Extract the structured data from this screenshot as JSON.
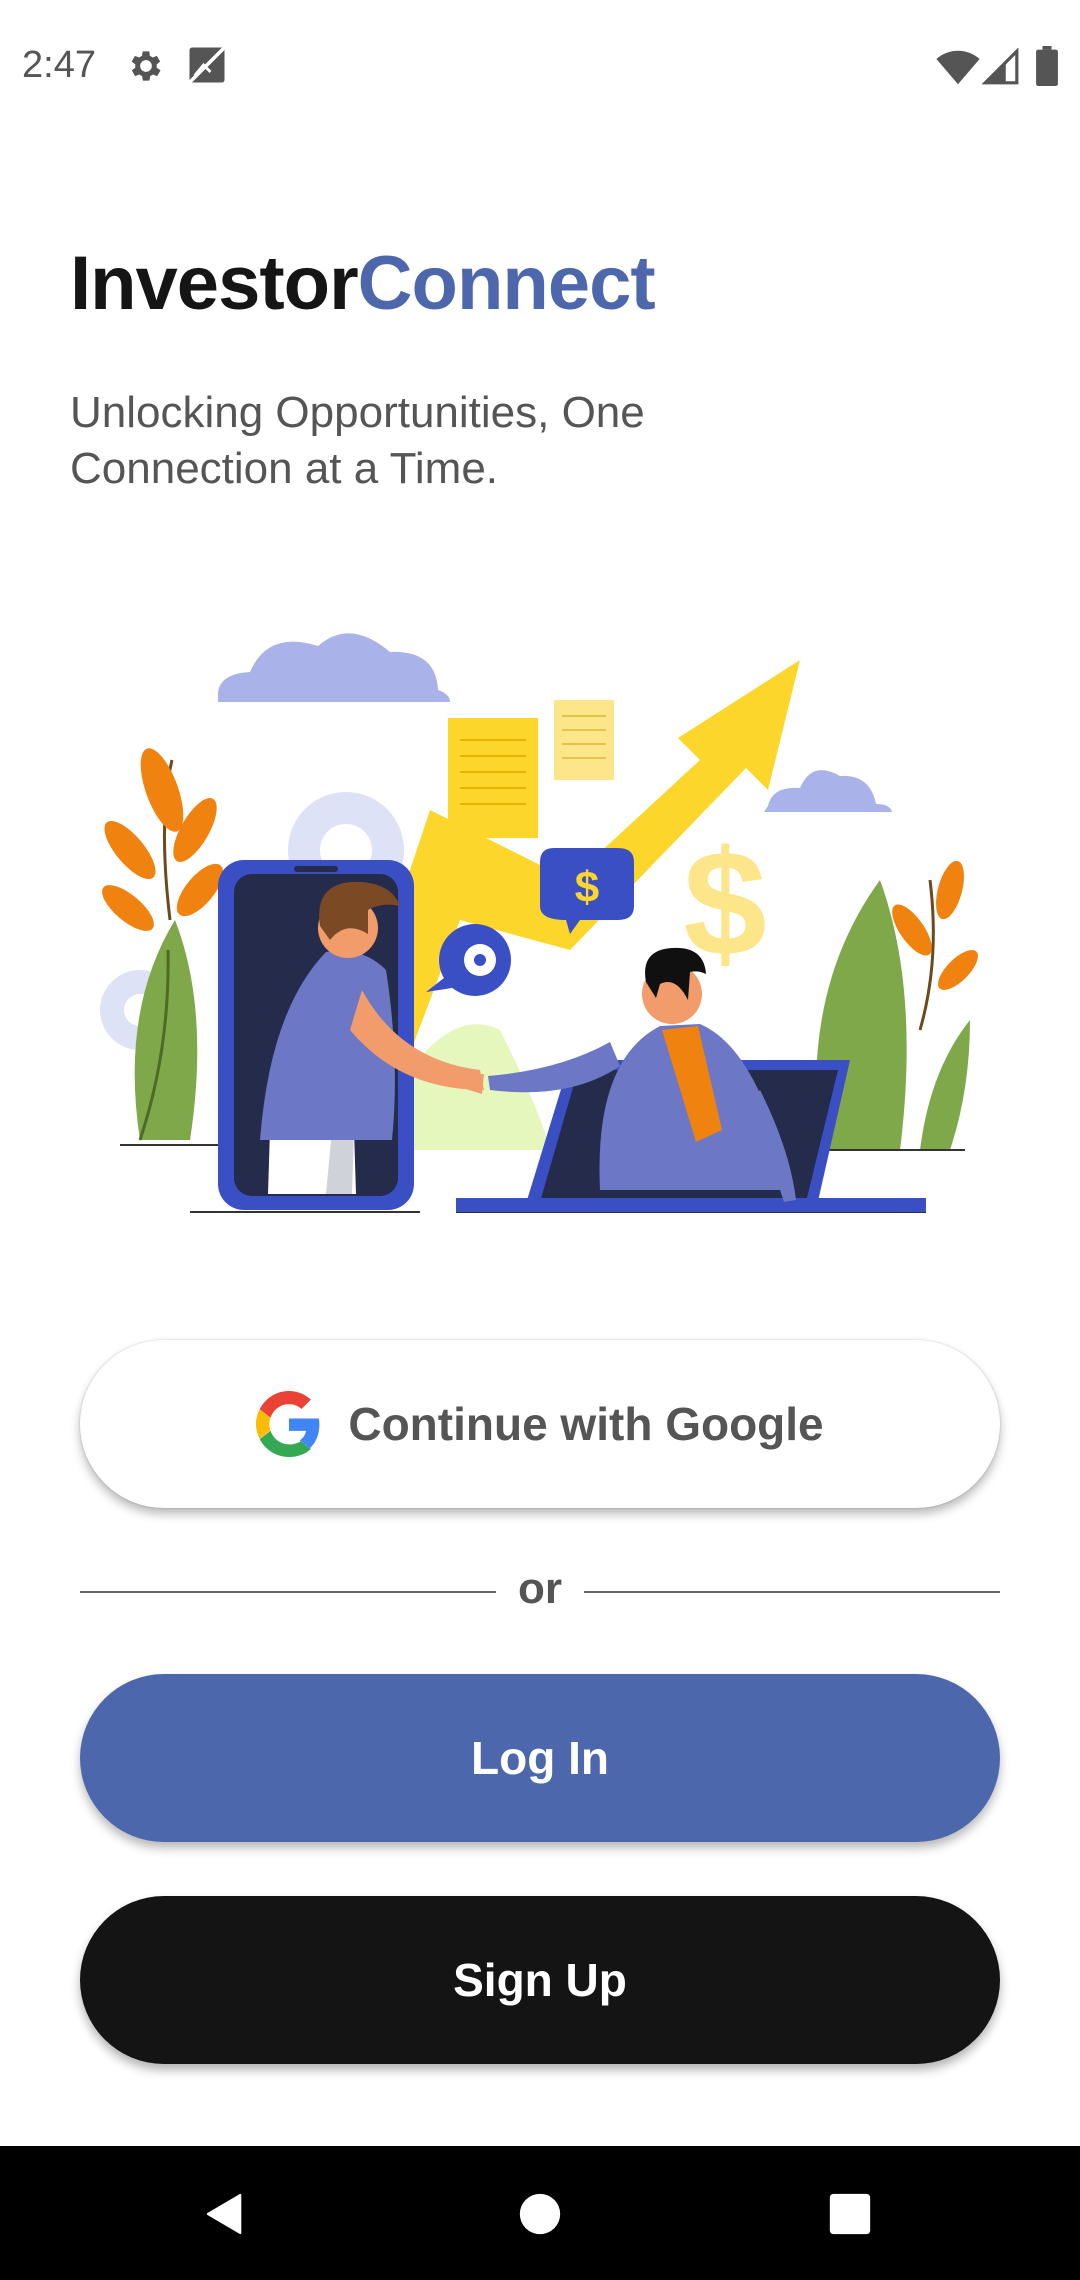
{
  "status_bar": {
    "time": "2:47",
    "icons": [
      "gear-icon",
      "image-icon",
      "wifi-icon",
      "signal-icon",
      "battery-icon"
    ]
  },
  "header": {
    "title_part1": "Investor",
    "title_part2": "Connect",
    "tagline": "Unlocking Opportunities, One Connection at a Time."
  },
  "hero": {
    "icon": "handshake-illustration"
  },
  "actions": {
    "google_label": "Continue with Google",
    "divider_label": "or",
    "login_label": "Log In",
    "signup_label": "Sign Up"
  },
  "nav_bar": {
    "icons": [
      "back-icon",
      "home-icon",
      "recents-icon"
    ]
  },
  "colors": {
    "brand": "#4d67ad",
    "title_dark": "#151515",
    "signup": "#141414",
    "text_muted": "#555555"
  }
}
